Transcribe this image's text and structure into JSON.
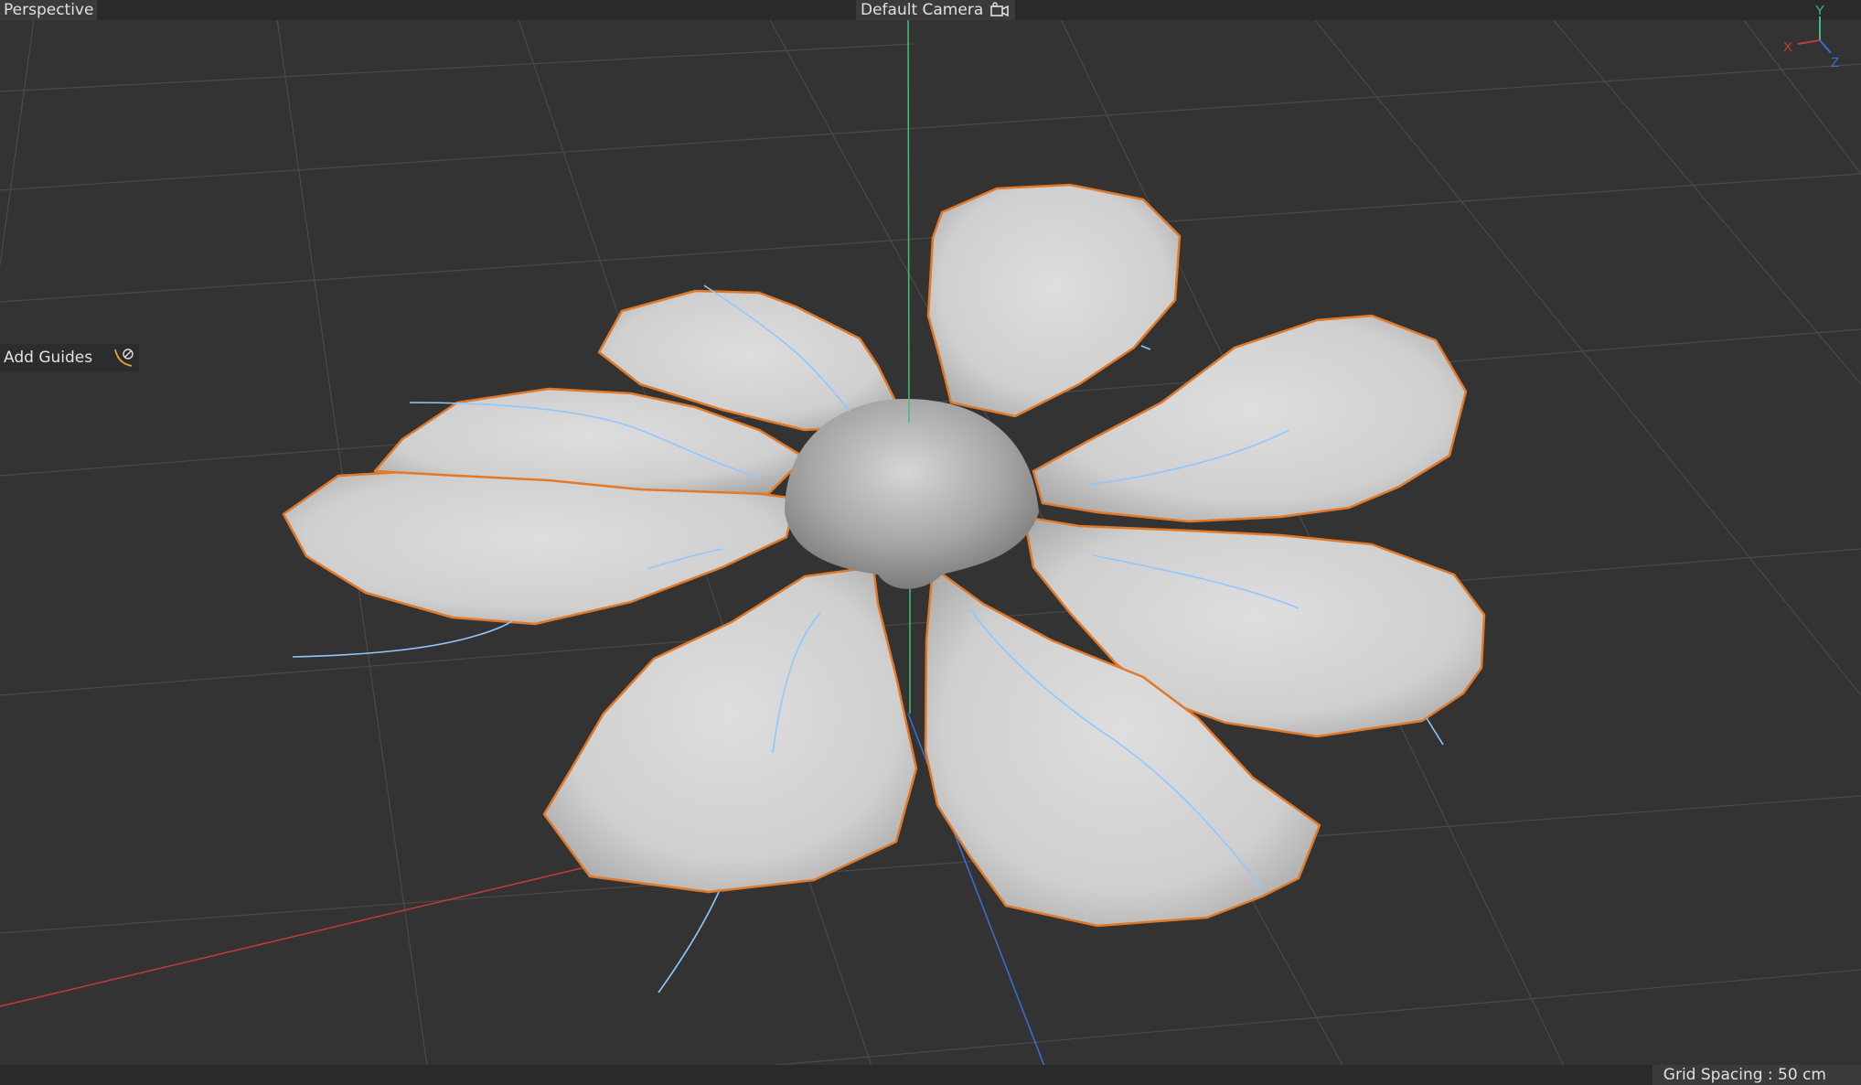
{
  "viewport": {
    "view_name": "Perspective",
    "camera_name": "Default Camera",
    "grid_spacing": "Grid Spacing : 50 cm"
  },
  "tools": {
    "add_guides_label": "Add Guides"
  },
  "gizmo": {
    "x_label": "X",
    "y_label": "Y",
    "z_label": "Z"
  },
  "colors": {
    "background": "#333333",
    "grid_line": "#4a4a4a",
    "x_axis": "#c23b3b",
    "y_axis": "#3fbf7f",
    "z_axis": "#3a6fd8",
    "selection_outline": "#e07a2a",
    "guide_curve": "#8ec8ff",
    "petal_fill": "#d8d8d8"
  },
  "icons": {
    "camera": "camera-icon",
    "guides": "guide-brush-icon"
  }
}
